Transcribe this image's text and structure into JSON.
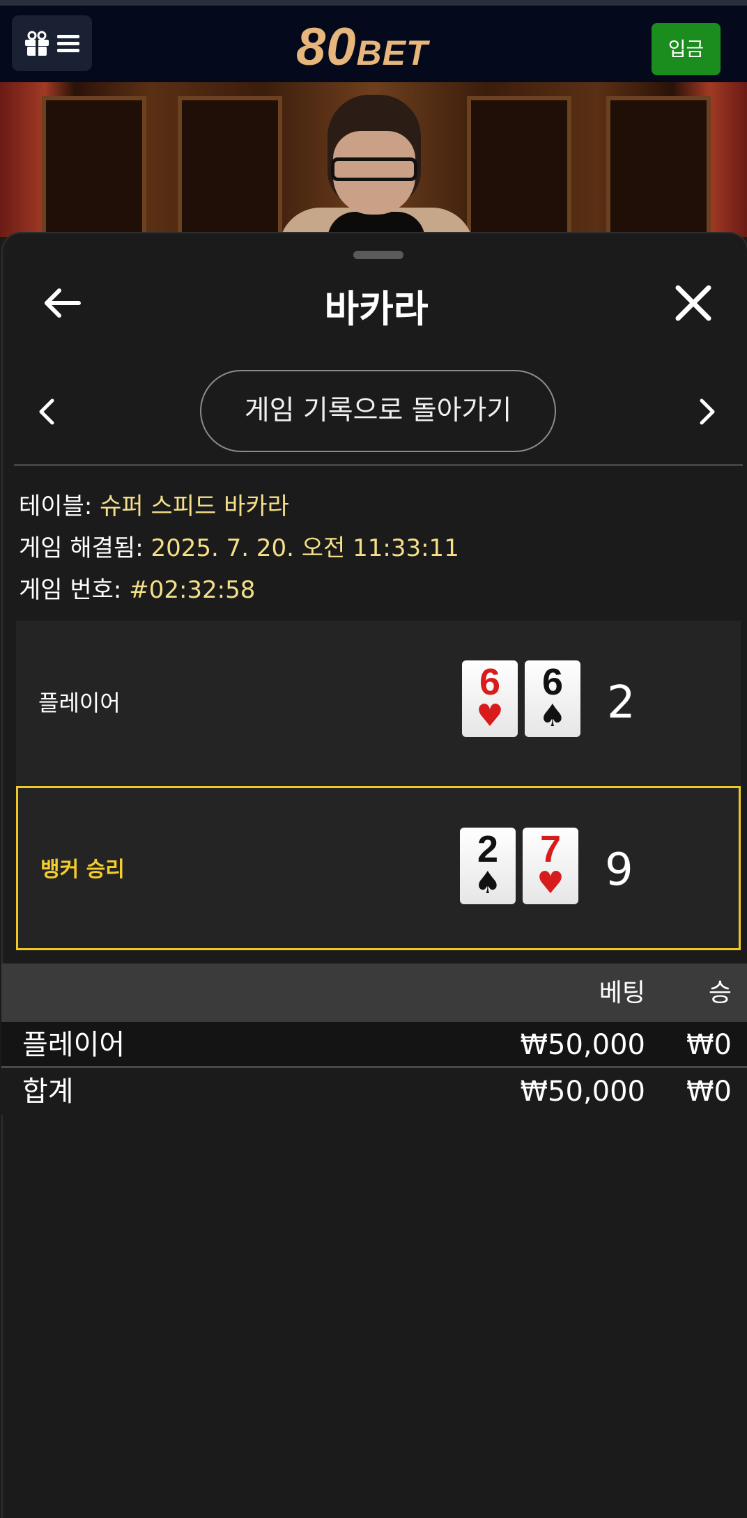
{
  "header": {
    "logo_main": "80",
    "logo_suffix": "BET",
    "deposit_label": "입금",
    "icons": [
      "gift-icon",
      "hamburger-menu-icon"
    ]
  },
  "sheet": {
    "title": "바카라",
    "history_button": "게임 기록으로 돌아가기",
    "icons": [
      "arrow-left-icon",
      "close-icon",
      "chevron-left-icon",
      "chevron-right-icon"
    ]
  },
  "info": {
    "table_label": "테이블:",
    "table_value": "슈퍼 스피드 바카라",
    "resolved_label": "게임 해결됨:",
    "resolved_value": "2025. 7. 20. 오전 11:33:11",
    "game_no_label": "게임 번호:",
    "game_no_value": "#02:32:58"
  },
  "hands": {
    "player": {
      "label": "플레이어",
      "cards": [
        {
          "rank": "6",
          "suit": "♥"
        },
        {
          "rank": "6",
          "suit": "♠"
        }
      ],
      "score": "2"
    },
    "banker": {
      "label": "뱅커 승리",
      "cards": [
        {
          "rank": "2",
          "suit": "♠"
        },
        {
          "rank": "7",
          "suit": "♥"
        }
      ],
      "score": "9"
    }
  },
  "bets_table": {
    "columns": [
      "",
      "베팅",
      "승"
    ],
    "rows": [
      {
        "name": "플레이어",
        "bet": "₩50,000",
        "win": "₩0"
      }
    ],
    "total": {
      "name": "합계",
      "bet": "₩50,000",
      "win": "₩0"
    }
  },
  "colors": {
    "accent_yellow": "#f0c824",
    "deposit_green": "#1b8d1f",
    "logo_gold": "#e7b67b",
    "card_red": "#d81c1c"
  }
}
